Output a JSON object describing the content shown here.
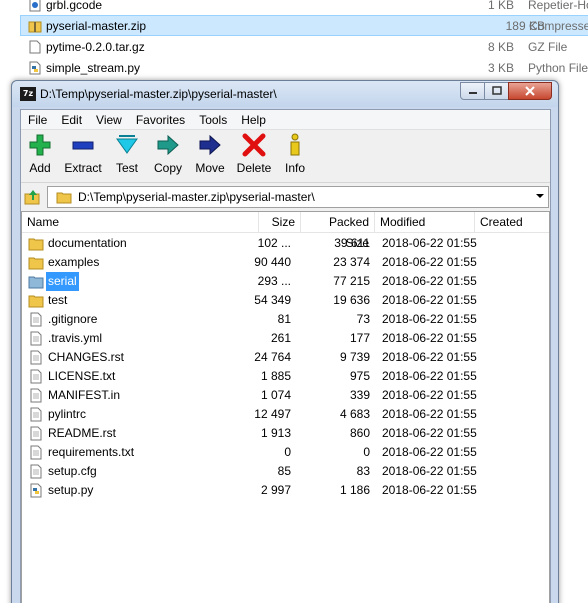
{
  "background_explorer": {
    "rows": [
      {
        "name": "grbl.gcode",
        "size": "1 KB",
        "type": "Repetier-Ho",
        "icon": "gcode-file-icon"
      },
      {
        "name": "pyserial-master.zip",
        "size": "189 KB",
        "type": "Compresse",
        "icon": "zip-folder-icon"
      },
      {
        "name": "pytime-0.2.0.tar.gz",
        "size": "8 KB",
        "type": "GZ File",
        "icon": "file-icon"
      },
      {
        "name": "simple_stream.py",
        "size": "3 KB",
        "type": "Python File",
        "icon": "python-file-icon"
      }
    ]
  },
  "window": {
    "title": "D:\\Temp\\pyserial-master.zip\\pyserial-master\\",
    "app_icon_text": "7z",
    "menu": [
      "File",
      "Edit",
      "View",
      "Favorites",
      "Tools",
      "Help"
    ],
    "toolbar": [
      {
        "label": "Add",
        "icon": "add-icon",
        "color": "#22b14c"
      },
      {
        "label": "Extract",
        "icon": "extract-icon",
        "color": "#1f3fbf"
      },
      {
        "label": "Test",
        "icon": "test-icon",
        "color": "#1ec8e6"
      },
      {
        "label": "Copy",
        "icon": "copy-icon",
        "color": "#1f9a8a"
      },
      {
        "label": "Move",
        "icon": "move-icon",
        "color": "#1f2f8f"
      },
      {
        "label": "Delete",
        "icon": "delete-icon",
        "color": "#e01010"
      },
      {
        "label": "Info",
        "icon": "info-icon",
        "color": "#e8c81a"
      }
    ],
    "address": "D:\\Temp\\pyserial-master.zip\\pyserial-master\\",
    "columns": [
      "Name",
      "Size",
      "Packed Size",
      "Modified",
      "Created"
    ],
    "files": [
      {
        "name": "documentation",
        "size": "102 ...",
        "packed": "39 611",
        "modified": "2018-06-22 01:55",
        "kind": "folder",
        "selected": false
      },
      {
        "name": "examples",
        "size": "90 440",
        "packed": "23 374",
        "modified": "2018-06-22 01:55",
        "kind": "folder",
        "selected": false
      },
      {
        "name": "serial",
        "size": "293 ...",
        "packed": "77 215",
        "modified": "2018-06-22 01:55",
        "kind": "folder",
        "selected": true
      },
      {
        "name": "test",
        "size": "54 349",
        "packed": "19 636",
        "modified": "2018-06-22 01:55",
        "kind": "folder",
        "selected": false
      },
      {
        "name": ".gitignore",
        "size": "81",
        "packed": "73",
        "modified": "2018-06-22 01:55",
        "kind": "file",
        "selected": false
      },
      {
        "name": ".travis.yml",
        "size": "261",
        "packed": "177",
        "modified": "2018-06-22 01:55",
        "kind": "file",
        "selected": false
      },
      {
        "name": "CHANGES.rst",
        "size": "24 764",
        "packed": "9 739",
        "modified": "2018-06-22 01:55",
        "kind": "file",
        "selected": false
      },
      {
        "name": "LICENSE.txt",
        "size": "1 885",
        "packed": "975",
        "modified": "2018-06-22 01:55",
        "kind": "file",
        "selected": false
      },
      {
        "name": "MANIFEST.in",
        "size": "1 074",
        "packed": "339",
        "modified": "2018-06-22 01:55",
        "kind": "file",
        "selected": false
      },
      {
        "name": "pylintrc",
        "size": "12 497",
        "packed": "4 683",
        "modified": "2018-06-22 01:55",
        "kind": "file",
        "selected": false
      },
      {
        "name": "README.rst",
        "size": "1 913",
        "packed": "860",
        "modified": "2018-06-22 01:55",
        "kind": "file",
        "selected": false
      },
      {
        "name": "requirements.txt",
        "size": "0",
        "packed": "0",
        "modified": "2018-06-22 01:55",
        "kind": "file",
        "selected": false
      },
      {
        "name": "setup.cfg",
        "size": "85",
        "packed": "83",
        "modified": "2018-06-22 01:55",
        "kind": "file",
        "selected": false
      },
      {
        "name": "setup.py",
        "size": "2 997",
        "packed": "1 186",
        "modified": "2018-06-22 01:55",
        "kind": "python",
        "selected": false
      }
    ]
  }
}
